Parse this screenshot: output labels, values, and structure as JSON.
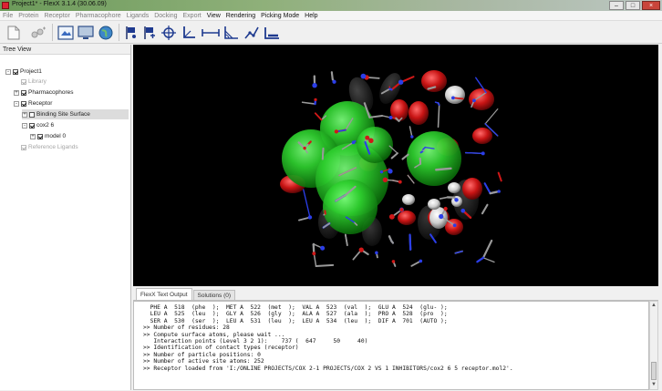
{
  "window": {
    "title": "Project1* - FlexX 3.1.4 (30.06.09)",
    "minimize": "–",
    "maximize": "□",
    "close": "×"
  },
  "menu": [
    "File",
    "Protein",
    "Receptor",
    "Pharmacophore",
    "Ligands",
    "Docking",
    "Export",
    "View",
    "Rendering",
    "Picking Mode",
    "Help"
  ],
  "menu_active": [
    "View",
    "Rendering",
    "Picking Mode",
    "Help"
  ],
  "toolbar_icons": [
    "new-document-icon",
    "add-icon",
    "screen-view-icon",
    "monitor-icon",
    "globe-icon",
    "flag-icon",
    "flag-alt-icon",
    "center-icon",
    "axis-icon",
    "distance-icon",
    "angle-icon",
    "torsion-icon",
    "measure-icon"
  ],
  "tree": {
    "title": "Tree View",
    "items": [
      {
        "label": "Project1",
        "level": 0,
        "expander": "-",
        "checked": true,
        "dim": false,
        "selected": false
      },
      {
        "label": "Library",
        "level": 1,
        "expander": "",
        "checked": true,
        "dim": true,
        "selected": false
      },
      {
        "label": "Pharmacophores",
        "level": 1,
        "expander": "+",
        "checked": true,
        "dim": false,
        "selected": false
      },
      {
        "label": "Receptor",
        "level": 1,
        "expander": "-",
        "checked": true,
        "dim": false,
        "selected": false
      },
      {
        "label": "Binding Site Surface",
        "level": 2,
        "expander": "+",
        "checked": false,
        "dim": false,
        "selected": true
      },
      {
        "label": "cox2 6",
        "level": 2,
        "expander": "-",
        "checked": true,
        "dim": false,
        "selected": false
      },
      {
        "label": "model 0",
        "level": 3,
        "expander": "+",
        "checked": true,
        "dim": false,
        "selected": false
      },
      {
        "label": "Reference Ligands",
        "level": 1,
        "expander": "",
        "checked": true,
        "dim": true,
        "selected": false
      }
    ]
  },
  "tabs": [
    "FlexX Text Output",
    "Solutions (0)"
  ],
  "active_tab": 0,
  "console_lines": [
    "  PHE A  518  (phe  );  MET A  522  (met  );  VAL A  523  (val  );  GLU A  524  (glu- );",
    "  LEU A  525  (leu  );  GLY A  526  (gly  );  ALA A  527  (ala  );  PRO A  528  (pro  );",
    "  SER A  530  (ser  );  LEU A  531  (leu  );  LEU A  534  (leu  );  DIF A  701  (AUTO );",
    ">> Number of residues: 28",
    ">> Compute surface atoms, please wait ...",
    "   Interaction points (Level 3 2 1):    737 (  647     50     40)",
    ">> Identification of contact types (receptor)",
    ">> Number of particle positions: 0",
    ">> Number of active site atoms: 252",
    ">> Receptor loaded from 'I:/ONLINE PROJECTS/COX 2-1 PROJECTS/COX 2 VS 1 INHIBITORS/cox2 6 5 receptor.mol2'."
  ],
  "scroll": {
    "up": "▲",
    "down": "▼"
  },
  "colors": {
    "viewer_bg": "#000000",
    "surface_green": "#2fd12f",
    "oxygen_red": "#d01818",
    "nitrogen_blue": "#2b3ee8",
    "carbon_gray": "#9a9a9a"
  }
}
